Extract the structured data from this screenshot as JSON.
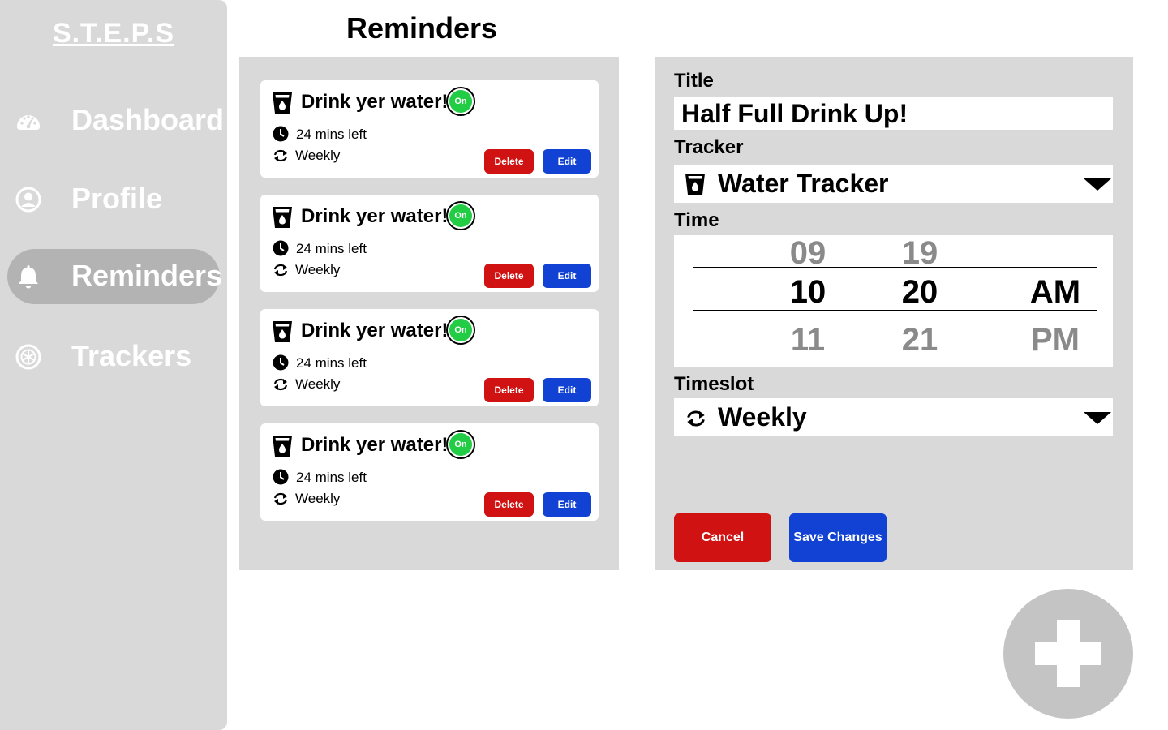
{
  "app": {
    "brand": "S.T.E.P.S"
  },
  "sidebar": {
    "items": [
      {
        "label": "Dashboard",
        "icon": "dashboard-gauge-icon"
      },
      {
        "label": "Profile",
        "icon": "profile-user-icon"
      },
      {
        "label": "Reminders",
        "icon": "bell-icon",
        "active": true
      },
      {
        "label": "Trackers",
        "icon": "trackers-aperture-icon"
      }
    ]
  },
  "page": {
    "title": "Reminders"
  },
  "reminders": [
    {
      "title": "Drink yer water!",
      "toggle": "On",
      "time_left": "24 mins left",
      "frequency": "Weekly",
      "delete_label": "Delete",
      "edit_label": "Edit"
    },
    {
      "title": "Drink yer water!",
      "toggle": "On",
      "time_left": "24 mins left",
      "frequency": "Weekly",
      "delete_label": "Delete",
      "edit_label": "Edit"
    },
    {
      "title": "Drink yer water!",
      "toggle": "On",
      "time_left": "24 mins left",
      "frequency": "Weekly",
      "delete_label": "Delete",
      "edit_label": "Edit"
    },
    {
      "title": "Drink yer water!",
      "toggle": "On",
      "time_left": "24 mins left",
      "frequency": "Weekly",
      "delete_label": "Delete",
      "edit_label": "Edit"
    }
  ],
  "form": {
    "title_label": "Title",
    "title_value": "Half Full Drink Up!",
    "tracker_label": "Tracker",
    "tracker_value": "Water Tracker",
    "time_label": "Time",
    "time_picker": {
      "hours": {
        "prev": "09",
        "selected": "10",
        "next": "11"
      },
      "minutes": {
        "prev": "19",
        "selected": "20",
        "next": "21"
      },
      "period": {
        "selected": "AM",
        "next": "PM"
      }
    },
    "timeslot_label": "Timeslot",
    "timeslot_value": "Weekly",
    "cancel_label": "Cancel",
    "save_label": "Save Changes"
  },
  "colors": {
    "sidebar_bg": "#d9d9d9",
    "active_nav": "#b3b3b3",
    "delete": "#d11212",
    "edit": "#1142d4",
    "toggle_on": "#22cc44",
    "fab": "#c4c4c4"
  }
}
